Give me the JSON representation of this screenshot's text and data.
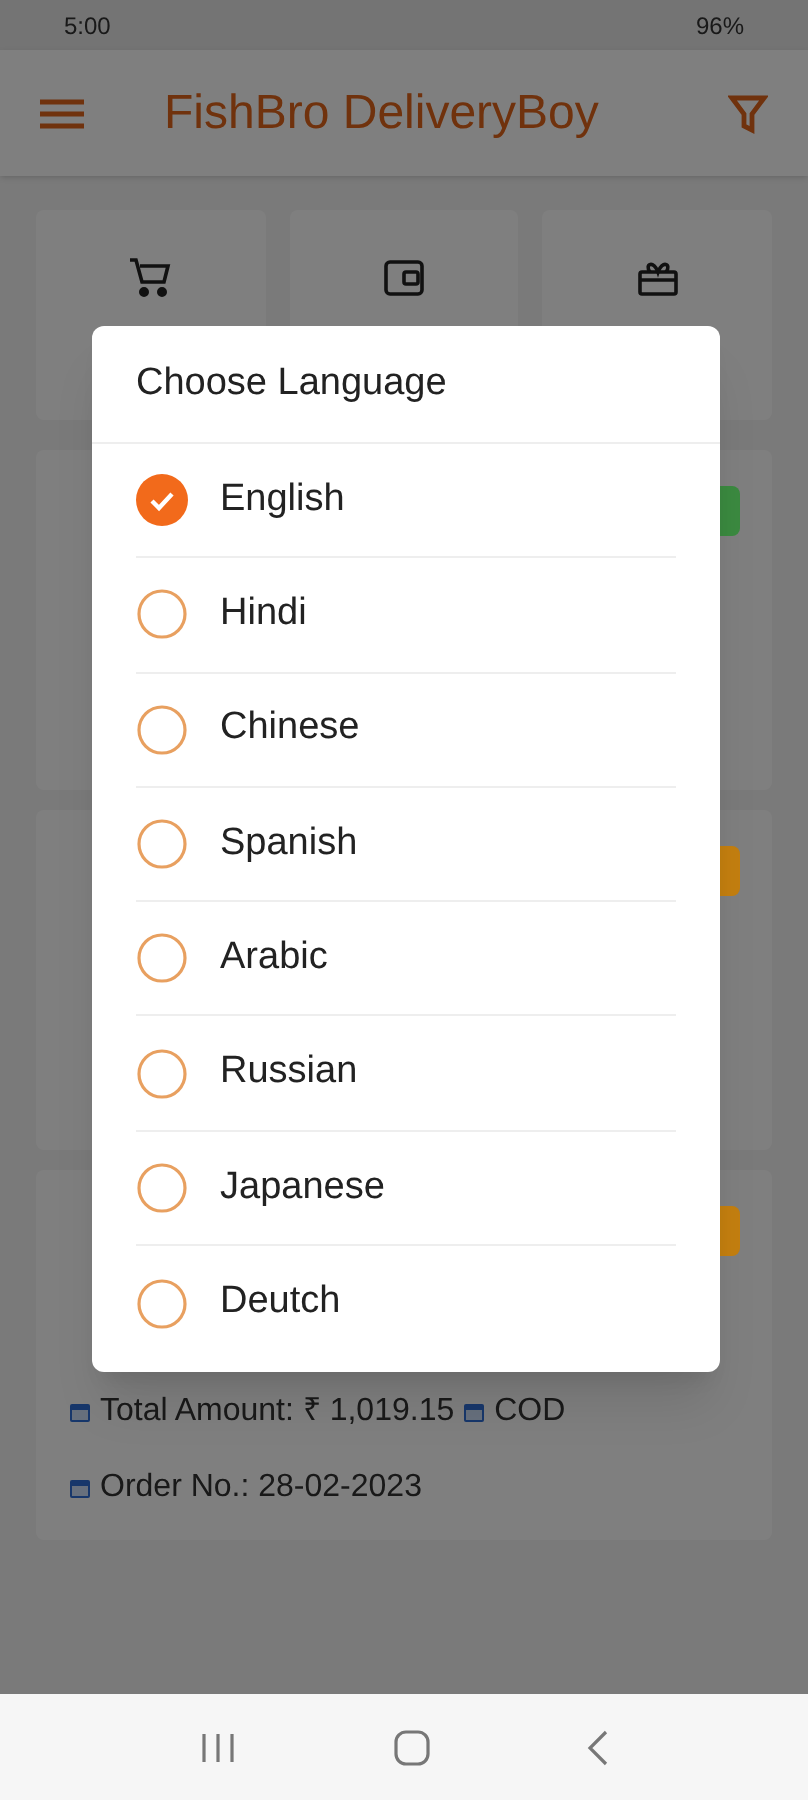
{
  "status_bar": {
    "time": "5:00",
    "battery": "96%"
  },
  "app_bar": {
    "title": "FishBro DeliveryBoy"
  },
  "orders": [
    {
      "color": "#3b8a40"
    },
    {
      "color": "#c47f10"
    },
    {
      "color": "#c47f10",
      "total_amount": "Total Amount: ₹ 1,019.15",
      "payment": "COD",
      "order_no": "Order No.: 28-02-2023"
    }
  ],
  "dialog": {
    "title": "Choose Language",
    "options": [
      {
        "label": "English",
        "selected": true
      },
      {
        "label": "Hindi",
        "selected": false
      },
      {
        "label": "Chinese",
        "selected": false
      },
      {
        "label": "Spanish",
        "selected": false
      },
      {
        "label": "Arabic",
        "selected": false
      },
      {
        "label": "Russian",
        "selected": false
      },
      {
        "label": "Japanese",
        "selected": false
      },
      {
        "label": "Deutch",
        "selected": false
      }
    ]
  }
}
